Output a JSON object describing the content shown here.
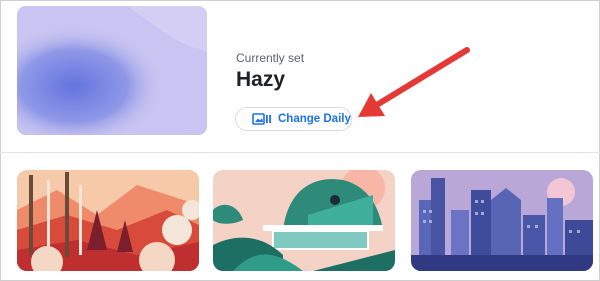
{
  "current": {
    "label": "Currently set",
    "name": "Hazy"
  },
  "change_button": {
    "label": "Change Daily",
    "icon": "wallpaper-slideshow-icon"
  },
  "wallpapers": [
    {
      "theme": "autumn-forest-illustration"
    },
    {
      "theme": "modern-house-illustration"
    },
    {
      "theme": "city-skyline-illustration"
    }
  ],
  "colors": {
    "accent": "#1a73e8",
    "annotation_arrow": "#e53935"
  }
}
